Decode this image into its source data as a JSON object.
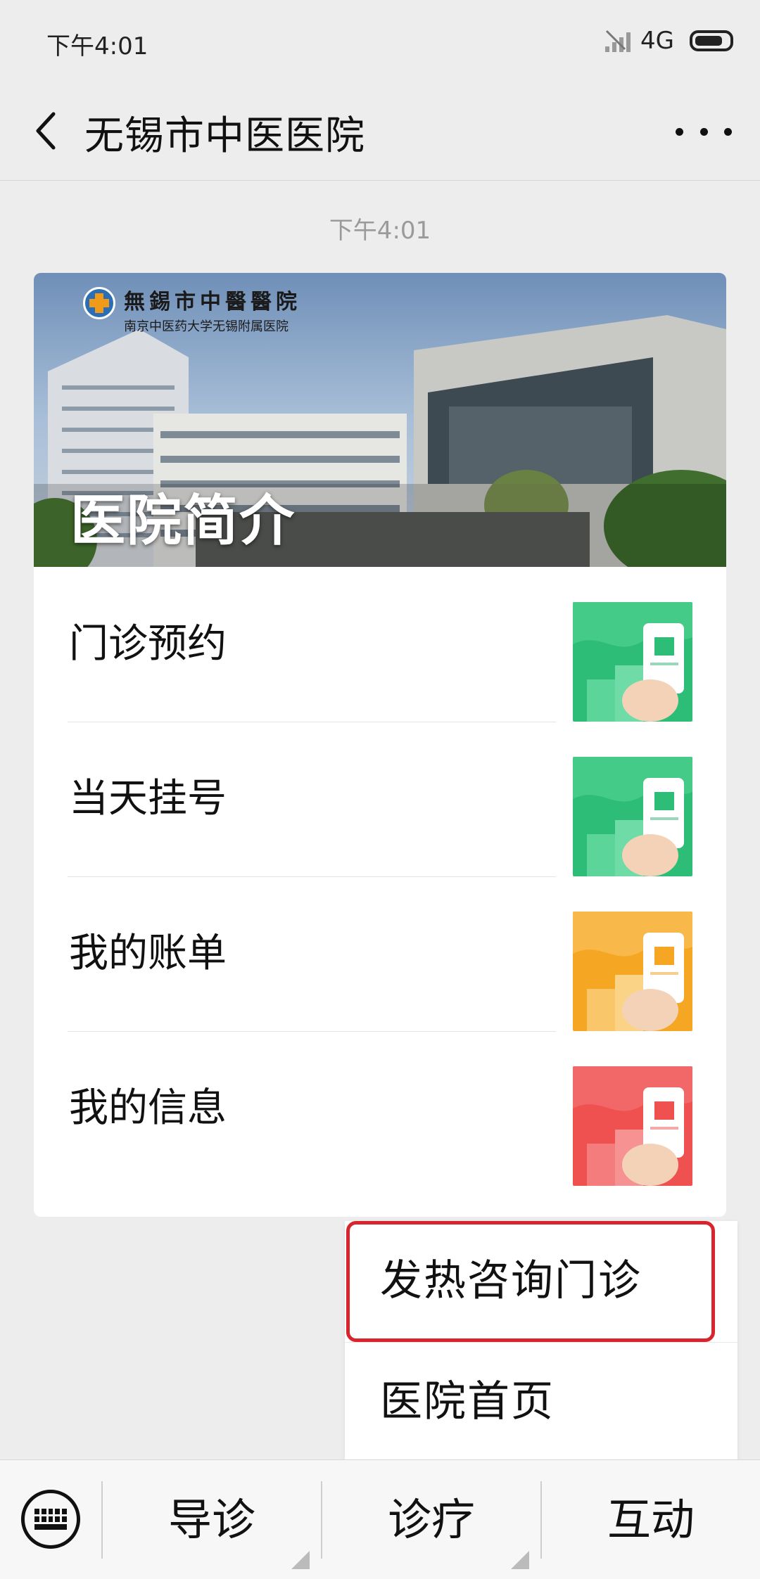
{
  "status_bar": {
    "time": "下午4:01",
    "network": "4G",
    "icons": [
      "signal-icon",
      "battery-icon"
    ]
  },
  "nav": {
    "title": "无锡市中医医院",
    "back_icon": "back-arrow-icon",
    "more_icon": "more-icon"
  },
  "message_time": "下午4:01",
  "card": {
    "banner": {
      "title": "医院简介",
      "logo_name": "無錫市中醫醫院",
      "logo_sub": "南京中医药大学无锡附属医院"
    },
    "items": [
      {
        "label": "门诊预约",
        "thumb_color": "#2ebd77",
        "thumb_icon": "calendar-phone-icon"
      },
      {
        "label": "当天挂号",
        "thumb_color": "#2ebd77",
        "thumb_icon": "calendar-phone-icon"
      },
      {
        "label": "我的账单",
        "thumb_color": "#f5a623",
        "thumb_icon": "bill-phone-icon"
      },
      {
        "label": "我的信息",
        "thumb_color": "#ef5050",
        "thumb_icon": "card-phone-icon"
      }
    ]
  },
  "popup_menu": {
    "items": [
      {
        "label": "发热咨询门诊",
        "highlighted": true
      },
      {
        "label": "医院首页"
      }
    ],
    "highlight_color": "#d9232d"
  },
  "bottom_bar": {
    "keyboard_icon": "keyboard-icon",
    "tabs": [
      {
        "label": "导诊"
      },
      {
        "label": "诊疗"
      },
      {
        "label": "互动"
      }
    ]
  }
}
